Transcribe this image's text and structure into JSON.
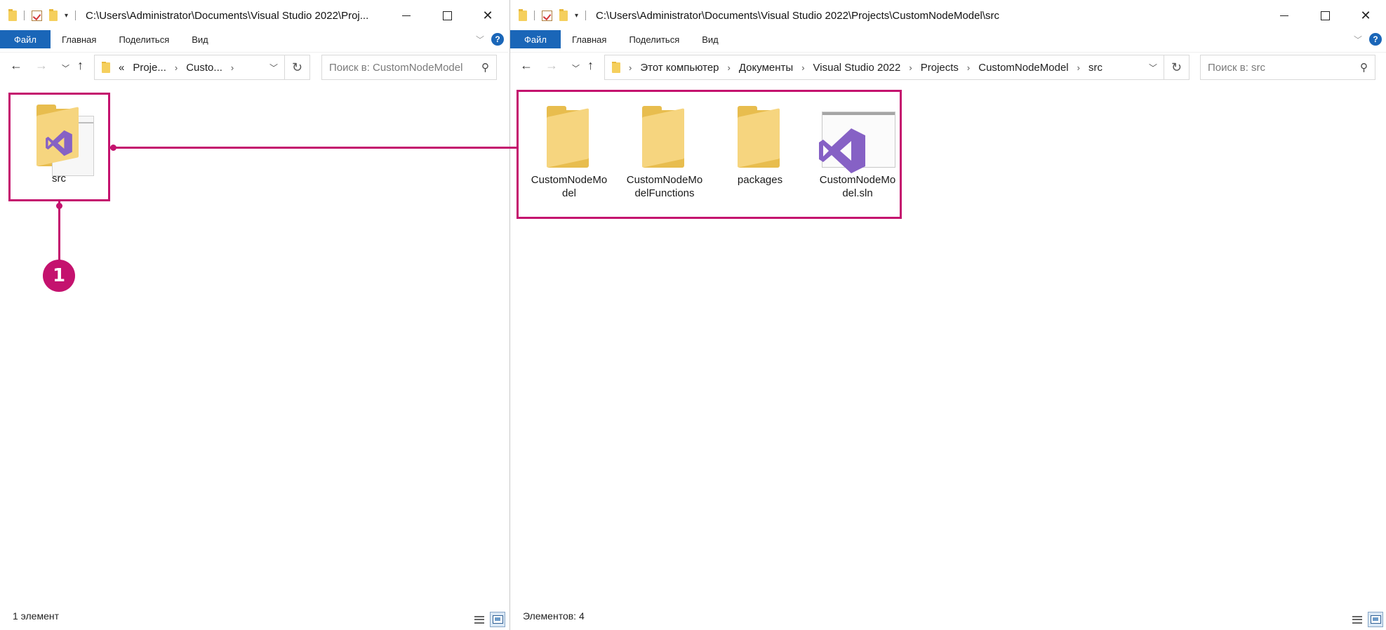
{
  "colors": {
    "accent": "#c4126e",
    "ribbon_file": "#1a66b8",
    "folder": "#f6d57f",
    "vs_purple": "#8661c5"
  },
  "left_window": {
    "title": "C:\\Users\\Administrator\\Documents\\Visual Studio 2022\\Proj...",
    "ribbon": {
      "file": "Файл",
      "home": "Главная",
      "share": "Поделиться",
      "view": "Вид"
    },
    "address": {
      "prefix": "«",
      "crumbs": [
        "Proje...",
        "Custo..."
      ]
    },
    "search_placeholder": "Поиск в: CustomNodeModel",
    "items": [
      {
        "label": "src",
        "icon": "folder-vs-icon"
      }
    ],
    "status": "1 элемент"
  },
  "right_window": {
    "title": "C:\\Users\\Administrator\\Documents\\Visual Studio 2022\\Projects\\CustomNodeModel\\src",
    "ribbon": {
      "file": "Файл",
      "home": "Главная",
      "share": "Поделиться",
      "view": "Вид"
    },
    "address": {
      "crumbs": [
        "Этот компьютер",
        "Документы",
        "Visual Studio 2022",
        "Projects",
        "CustomNodeModel",
        "src"
      ]
    },
    "search_placeholder": "Поиск в: src",
    "items": [
      {
        "label": "CustomNodeMo del",
        "icon": "folder-icon"
      },
      {
        "label": "CustomNodeMo delFunctions",
        "icon": "folder-icon"
      },
      {
        "label": "packages",
        "icon": "folder-icon"
      },
      {
        "label": "CustomNodeMo del.sln",
        "icon": "visual-studio-solution-icon"
      }
    ],
    "status": "Элементов: 4"
  },
  "annotation": {
    "badge": "1"
  }
}
